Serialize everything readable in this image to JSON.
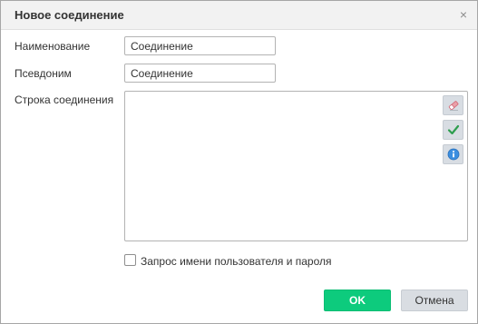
{
  "dialog": {
    "title": "Новое соединение",
    "close_glyph": "×"
  },
  "form": {
    "name_label": "Наименование",
    "name_value": "Соединение",
    "alias_label": "Псевдоним",
    "alias_value": "Соединение",
    "connection_string_label": "Строка соединения",
    "connection_string_value": ""
  },
  "side_buttons": [
    {
      "icon": "eraser-icon"
    },
    {
      "icon": "checkmark-icon"
    },
    {
      "icon": "info-icon"
    }
  ],
  "checkbox": {
    "label": "Запрос имени пользователя и пароля",
    "checked": false
  },
  "buttons": {
    "ok_label": "OK",
    "cancel_label": "Отмена"
  },
  "colors": {
    "ok_button": "#0dcb7d",
    "cancel_button": "#d9dde2",
    "side_button": "#d8dde3",
    "titlebar": "#f2f2f2"
  }
}
